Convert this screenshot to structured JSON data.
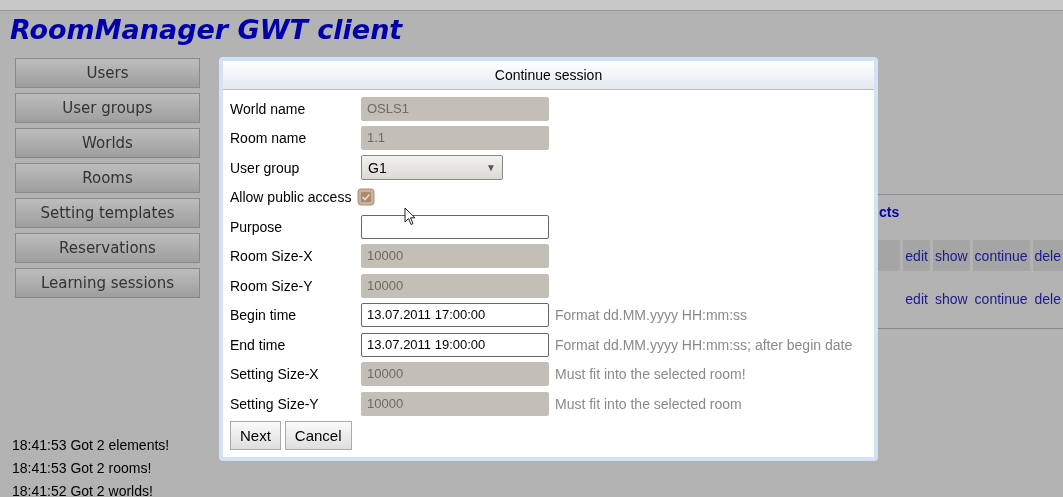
{
  "app_title": "RoomManager GWT client",
  "nav": [
    "Users",
    "User groups",
    "Worlds",
    "Rooms",
    "Setting templates",
    "Reservations",
    "Learning sessions"
  ],
  "log": [
    "18:41:53 Got 2 elements!",
    "18:41:53 Got 2 rooms!",
    "18:41:52 Got 2 worlds!"
  ],
  "background_section": {
    "heading": "cts",
    "rows": [
      {
        "kind": "header",
        "links": [
          "edit",
          "show",
          "continue",
          "dele"
        ]
      },
      {
        "kind": "plain",
        "links": [
          "edit",
          "show",
          "continue",
          "dele"
        ]
      }
    ]
  },
  "dialog": {
    "title": "Continue session",
    "fields": [
      {
        "label": "World name",
        "kind": "text",
        "value": "OSLS1",
        "disabled": true
      },
      {
        "label": "Room name",
        "kind": "text",
        "value": "1.1",
        "disabled": true
      },
      {
        "label": "User group",
        "kind": "select",
        "value": "G1",
        "arrow": "▼"
      },
      {
        "label": "Allow public access",
        "kind": "checkbox",
        "checked": true
      },
      {
        "label": "Purpose",
        "kind": "text",
        "disabled": false
      },
      {
        "label": "Room Size-X",
        "kind": "text",
        "value": "10000",
        "disabled": true
      },
      {
        "label": "Room Size-Y",
        "kind": "text",
        "value": "10000",
        "disabled": true
      },
      {
        "label": "Begin time",
        "kind": "text",
        "value": "13.07.2011 17:00:00",
        "disabled": false,
        "hint": "Format dd.MM.yyyy HH:mm:ss"
      },
      {
        "label": "End time",
        "kind": "text",
        "value": "13.07.2011 19:00:00",
        "disabled": false,
        "hint": "Format dd.MM.yyyy HH:mm:ss; after begin date"
      },
      {
        "label": "Setting Size-X",
        "kind": "text",
        "value": "10000",
        "disabled": true,
        "hint": "Must fit into the selected room!"
      },
      {
        "label": "Setting Size-Y",
        "kind": "text",
        "value": "10000",
        "disabled": true,
        "hint": "Must fit into the selected room"
      }
    ],
    "buttons": [
      "Next",
      "Cancel"
    ]
  }
}
